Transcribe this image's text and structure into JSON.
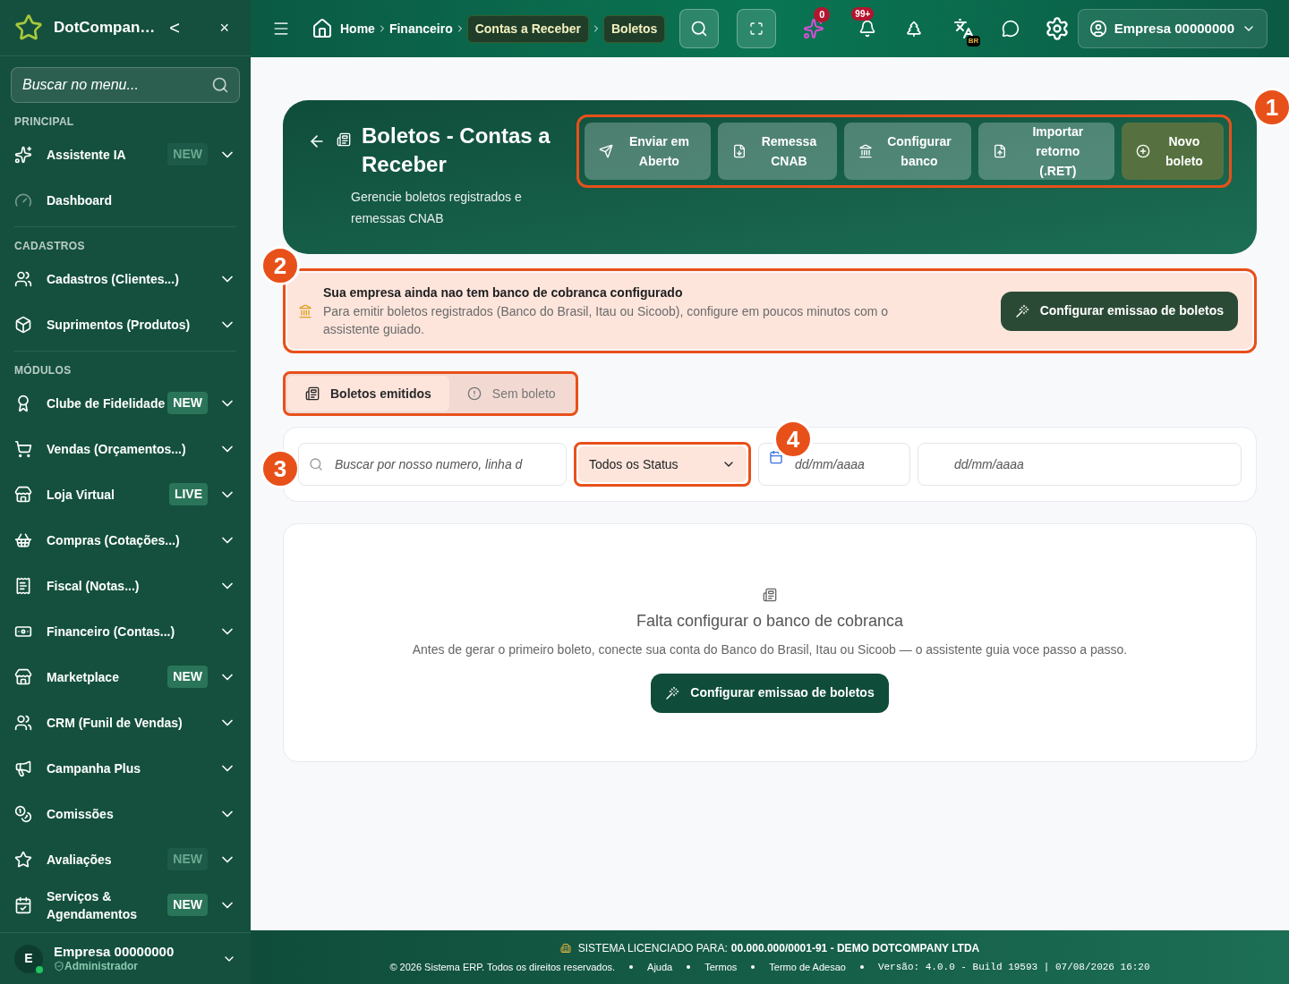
{
  "brand": {
    "name": "DotCompan…",
    "collapse": "<",
    "close": "×"
  },
  "sidebar": {
    "search_placeholder": "Buscar no menu...",
    "sections": [
      {
        "title": "PRINCIPAL",
        "items": [
          {
            "label": "Assistente IA",
            "badge": "NEW",
            "badge_muted": true,
            "expandable": true
          },
          {
            "label": "Dashboard",
            "expandable": false
          }
        ]
      },
      {
        "title": "CADASTROS",
        "items": [
          {
            "label": "Cadastros (Clientes...)",
            "expandable": true
          },
          {
            "label": "Suprimentos (Produtos)",
            "expandable": true
          }
        ]
      },
      {
        "title": "MÓDULOS",
        "items": [
          {
            "label": "Clube de Fidelidade",
            "badge": "NEW",
            "badge_muted": false,
            "expandable": true
          },
          {
            "label": "Vendas (Orçamentos...)",
            "expandable": true
          },
          {
            "label": "Loja Virtual",
            "badge": "LIVE",
            "badge_muted": false,
            "expandable": true
          },
          {
            "label": "Compras (Cotações...)",
            "expandable": true
          },
          {
            "label": "Fiscal (Notas...)",
            "expandable": true
          },
          {
            "label": "Financeiro (Contas...)",
            "expandable": true
          },
          {
            "label": "Marketplace",
            "badge": "NEW",
            "badge_muted": false,
            "expandable": true
          },
          {
            "label": "CRM (Funil de Vendas)",
            "expandable": true
          },
          {
            "label": "Campanha Plus",
            "expandable": true
          },
          {
            "label": "Comissões",
            "expandable": true
          },
          {
            "label": "Avaliações",
            "badge": "NEW",
            "badge_muted": true,
            "expandable": true
          },
          {
            "label": "Serviços & Agendamentos",
            "badge": "NEW",
            "badge_muted": false,
            "expandable": true
          }
        ]
      }
    ],
    "user": {
      "initial": "E",
      "name": "Empresa 00000000",
      "role": "Administrador"
    }
  },
  "topbar": {
    "breadcrumbs": [
      {
        "label": "Home",
        "selected": false
      },
      {
        "label": "Financeiro",
        "selected": false
      },
      {
        "label": "Contas a Receber",
        "selected": true
      },
      {
        "label": "Boletos",
        "selected": true
      }
    ],
    "ai_count": "0",
    "notifications_count": "99+",
    "language": "BR",
    "account": "Empresa 00000000"
  },
  "header": {
    "title": "Boletos - Contas a Receber",
    "subtitle": "Gerencie boletos registrados e remessas CNAB",
    "actions": [
      {
        "label": "Enviar em Aberto",
        "kind": "plain"
      },
      {
        "label": "Remessa CNAB",
        "kind": "plain"
      },
      {
        "label": "Configurar banco",
        "kind": "plain"
      },
      {
        "label": "Importar retorno (.RET)",
        "kind": "plain"
      },
      {
        "label": "Novo boleto",
        "kind": "primary"
      }
    ]
  },
  "alert": {
    "title": "Sua empresa ainda nao tem banco de cobranca configurado",
    "text": "Para emitir boletos registrados (Banco do Brasil, Itau ou Sicoob), configure em poucos minutos com o assistente guiado.",
    "button": "Configurar emissao de boletos"
  },
  "tabs": [
    {
      "label": "Boletos emitidos",
      "selected": true
    },
    {
      "label": "Sem boleto",
      "selected": false
    }
  ],
  "filters": {
    "search_placeholder": "Buscar por nosso numero, linha d",
    "status": "Todos os Status",
    "date_from_placeholder": "dd/mm/aaaa",
    "date_to_placeholder": "dd/mm/aaaa"
  },
  "empty": {
    "title": "Falta configurar o banco de cobranca",
    "text": "Antes de gerar o primeiro boleto, conecte sua conta do Banco do Brasil, Itau ou Sicoob — o assistente guia voce passo a passo.",
    "button": "Configurar emissao de boletos"
  },
  "annotations": [
    "1",
    "2",
    "3",
    "4"
  ],
  "footer": {
    "license_label": "SISTEMA LICENCIADO PARA:",
    "license_value": "00.000.000/0001-91 - DEMO DOTCOMPANY LTDA",
    "copyright": "© 2026 Sistema ERP. Todos os direitos reservados.",
    "links": [
      "Ajuda",
      "Termos",
      "Termo de Adesao"
    ],
    "version": "Versão: 4.0.0 - Build 19593 | 07/08/2026 16:20"
  }
}
